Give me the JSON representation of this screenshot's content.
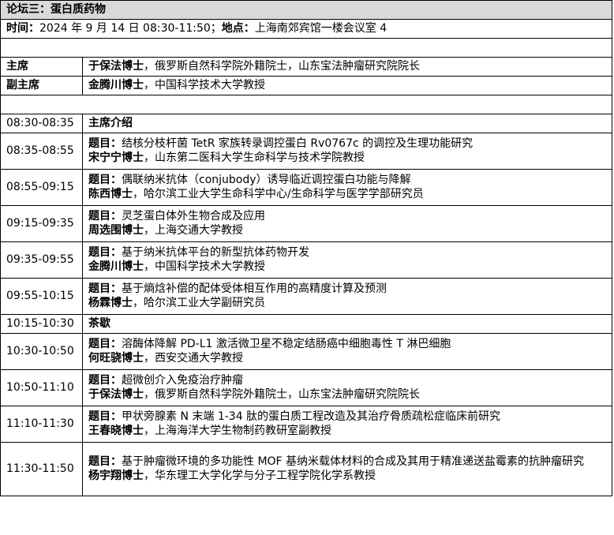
{
  "forum_title": "论坛三：蛋白质药物",
  "info": {
    "time_label": "时间：",
    "time_value": "2024 年 9 月 14 日 08:30-11:50；",
    "place_label": "地点：",
    "place_value": "上海南郊宾馆一楼会议室 4"
  },
  "chairs": [
    {
      "role": "主席",
      "name": "于保法博士",
      "affiliation": "，俄罗斯自然科学院外籍院士，山东宝法肿瘤研究院院长"
    },
    {
      "role": "副主席",
      "name": "金腾川博士",
      "affiliation": "，中国科学技术大学教授"
    }
  ],
  "schedule": [
    {
      "time": "08:30-08:35",
      "plain": "主席介绍"
    },
    {
      "time": "08:35-08:55",
      "topic_label": "题目：",
      "topic": "结核分枝杆菌 TetR 家族转录调控蛋白 Rv0767c 的调控及生理功能研究",
      "speaker": "宋宁宁博士",
      "affiliation": "，山东第二医科大学生命科学与技术学院教授"
    },
    {
      "time": "08:55-09:15",
      "topic_label": "题目：",
      "topic": "偶联纳米抗体（conjubody）诱导临近调控蛋白功能与降解",
      "speaker": "陈西博士",
      "affiliation": "，哈尔滨工业大学生命科学中心/生命科学与医学学部研究员"
    },
    {
      "time": "09:15-09:35",
      "topic_label": "题目：",
      "topic": "灵芝蛋白体外生物合成及应用",
      "speaker": "周选围博士",
      "affiliation": "，上海交通大学教授"
    },
    {
      "time": "09:35-09:55",
      "topic_label": "题目：",
      "topic": "基于纳米抗体平台的新型抗体药物开发",
      "speaker": "金腾川博士",
      "affiliation": "，中国科学技术大学教授"
    },
    {
      "time": "09:55-10:15",
      "topic_label": "题目：",
      "topic": "基于熵焓补偿的配体受体相互作用的高精度计算及预测",
      "speaker": "杨霖博士",
      "affiliation": "，哈尔滨工业大学副研究员"
    },
    {
      "time": "10:15-10:30",
      "plain": "茶歇"
    },
    {
      "time": "10:30-10:50",
      "topic_label": "题目：",
      "topic": "溶酶体降解 PD-L1 激活微卫星不稳定结肠癌中细胞毒性 T 淋巴细胞",
      "speaker": "何旺骁博士",
      "affiliation": "，西安交通大学教授"
    },
    {
      "time": "10:50-11:10",
      "topic_label": "题目：",
      "topic": "超微创介入免疫治疗肿瘤",
      "speaker": "于保法博士",
      "affiliation": "，俄罗斯自然科学院外籍院士，山东宝法肿瘤研究院院长"
    },
    {
      "time": "11:10-11:30",
      "topic_label": "题目：",
      "topic": "甲状旁腺素 N 末端 1-34 肽的蛋白质工程改造及其治疗骨质疏松症临床前研究",
      "speaker": "王春晓博士",
      "affiliation": "，上海海洋大学生物制药教研室副教授"
    },
    {
      "time": "11:30-11:50",
      "topic_label": "题目：",
      "topic": "基于肿瘤微环境的多功能性 MOF 基纳米载体材料的合成及其用于精准递送盐霉素的抗肿瘤研究",
      "speaker": "杨宇翔博士",
      "affiliation": "，华东理工大学化学与分子工程学院化学系教授"
    }
  ]
}
